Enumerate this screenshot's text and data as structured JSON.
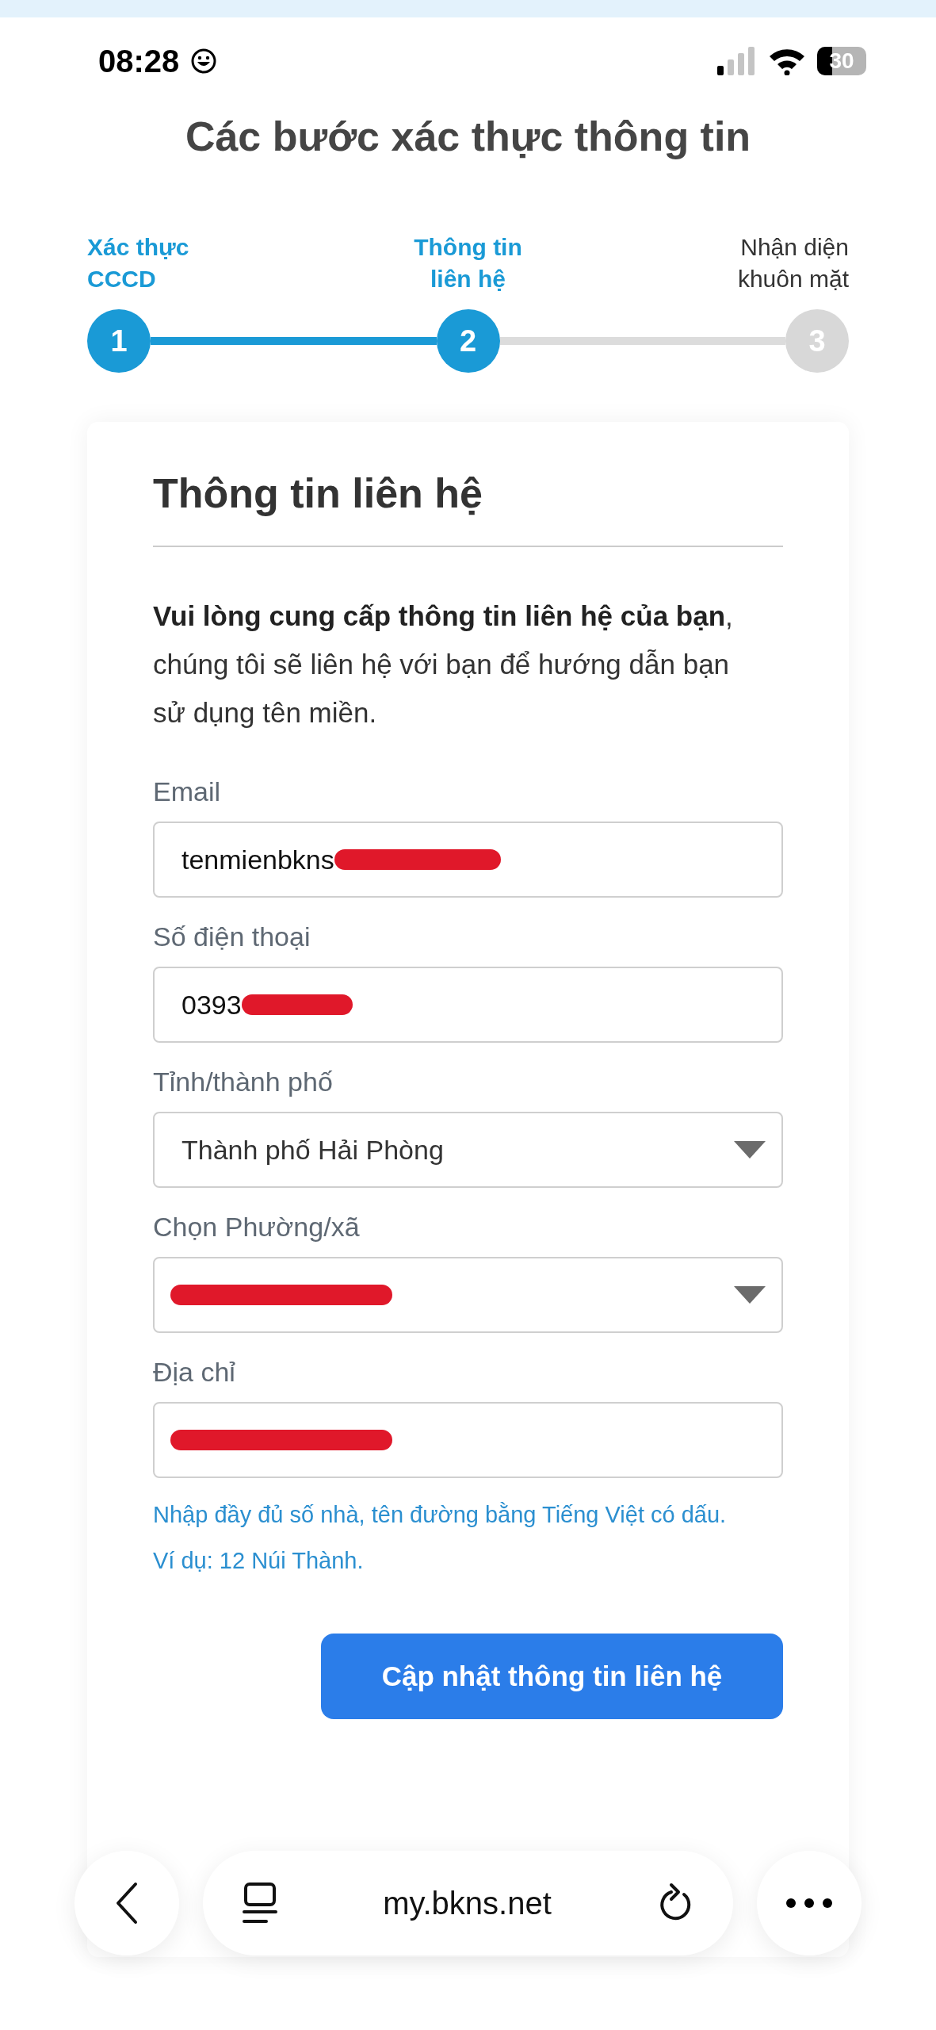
{
  "status_bar": {
    "time": "08:28",
    "battery": "30"
  },
  "title": "Các bước xác thực thông tin",
  "steps": [
    {
      "number": "1",
      "label": "Xác thực CCCD",
      "active": true
    },
    {
      "number": "2",
      "label": "Thông tin liên hệ",
      "active": true
    },
    {
      "number": "3",
      "label": "Nhận diện khuôn mặt",
      "active": false
    }
  ],
  "form": {
    "heading": "Thông tin liên hệ",
    "intro": "**Vui lòng cung cấp thông tin liên hệ của bạn**, chúng tôi sẽ liên hệ với bạn để hướng dẫn bạn sử dụng tên miền.",
    "fields": [
      {
        "label": "Email",
        "kind": "text",
        "value": "tenmienbkns",
        "redacted": true
      },
      {
        "label": "Số điện thoại",
        "kind": "text",
        "value": "0393",
        "redacted": true
      },
      {
        "label": "Tỉnh/thành phố",
        "kind": "select",
        "value": "Thành phố Hải Phòng",
        "redacted": false
      },
      {
        "label": "Chọn Phường/xã",
        "kind": "select",
        "redacted": true
      },
      {
        "label": "Địa chỉ",
        "kind": "text",
        "redacted": true
      }
    ],
    "hints": [
      "Nhập đầy đủ số nhà, tên đường bằng Tiếng Việt có dấu.",
      "Ví dụ: 12 Núi Thành."
    ],
    "button": "Cập nhật thông tin liên hệ"
  },
  "browser_bar": {
    "url": "my.bkns.net"
  }
}
